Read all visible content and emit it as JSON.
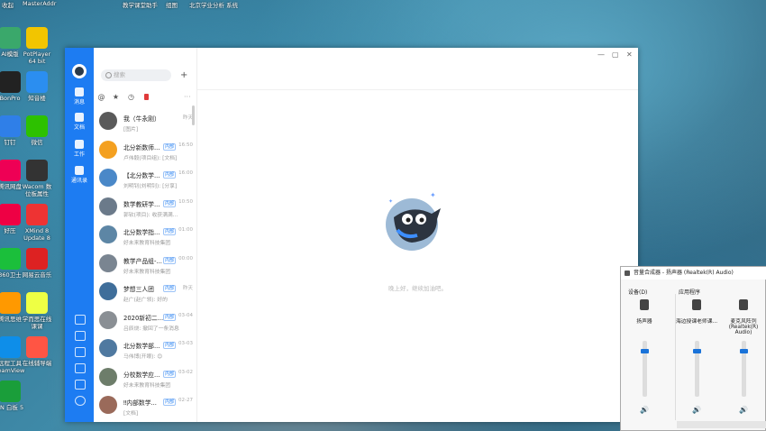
{
  "desktop": {
    "top_labels": [
      "收起",
      "MasterAddr",
      "教学课堂助手",
      "组图",
      "北京学业分析\n系统"
    ],
    "icons": [
      {
        "label": "AI模版",
        "color": "#3aa86b"
      },
      {
        "label": "PotPlayer 64 bit",
        "color": "#f2c500"
      },
      {
        "label": "BonPro",
        "color": "#222"
      },
      {
        "label": "知音楼",
        "color": "#2b8ef0"
      },
      {
        "label": "钉钉",
        "color": "#2f7fe8"
      },
      {
        "label": "微信",
        "color": "#2dc100"
      },
      {
        "label": "腾讯网盘",
        "color": "#e05"
      },
      {
        "label": "Wacom 数位板属性",
        "color": "#333"
      },
      {
        "label": "好压",
        "color": "#e04"
      },
      {
        "label": "XMind 8 Update 8",
        "color": "#e33"
      },
      {
        "label": "360卫士",
        "color": "#1bbf3b"
      },
      {
        "label": "网易云音乐",
        "color": "#d22"
      },
      {
        "label": "腾讯思维",
        "color": "#ff9900"
      },
      {
        "label": "学而思在线课课",
        "color": "#ef4"
      },
      {
        "label": "远程工具 TeamView",
        "color": "#0e8ee9"
      },
      {
        "label": "在线辅导端",
        "color": "#f54"
      },
      {
        "label": "EN 白板 5",
        "color": "#1a9e3a"
      }
    ]
  },
  "main_window": {
    "search": {
      "placeholder": "搜索"
    },
    "add_label": "+",
    "rail": [
      {
        "label": "消息"
      },
      {
        "label": "文档"
      },
      {
        "label": "工作"
      },
      {
        "label": "通讯录"
      }
    ],
    "filters": {
      "mention": "@",
      "star": "★",
      "clock": "◷",
      "more": "···"
    },
    "chats": [
      {
        "name": "我（牛永刚）",
        "badge": "",
        "time": "昨天",
        "preview": "[图片]",
        "avatar": "#5a5a5a"
      },
      {
        "name": "北分新数师...",
        "badge": "内部",
        "time": "16:50",
        "preview": "卢伟毅(项目组): [文档]",
        "avatar": "#f4a020"
      },
      {
        "name": "【北分数学...",
        "badge": "内部",
        "time": "16:00",
        "preview": "刘明钊(刘明钊): [分享]",
        "avatar": "#4a88c8"
      },
      {
        "name": "数学教研学...",
        "badge": "内部",
        "time": "10:50",
        "preview": "郭钦(项目): 收获满满...",
        "avatar": "#6b7a8a"
      },
      {
        "name": "北分数学指...",
        "badge": "内部",
        "time": "01:00",
        "preview": "好未来教育科技集团",
        "avatar": "#5d86a5"
      },
      {
        "name": "教学产品组-...",
        "badge": "内部",
        "time": "00:00",
        "preview": "好未来教育科技集团",
        "avatar": "#7a8591"
      },
      {
        "name": "梦想三人团",
        "badge": "内部",
        "time": "昨天",
        "preview": "赵广(赵广领): 好的",
        "avatar": "#3f6e9a"
      },
      {
        "name": "2020新初二...",
        "badge": "内部",
        "time": "03-04",
        "preview": "吕辰烧: 撤回了一条消息",
        "avatar": "#8a8f94"
      },
      {
        "name": "北分数学部...",
        "badge": "内部",
        "time": "03-03",
        "preview": "马伟博(开眼): 😊",
        "avatar": "#4f79a0"
      },
      {
        "name": "分校数学应...",
        "badge": "内部",
        "time": "03-02",
        "preview": "好未来教育科技集团",
        "avatar": "#6d7d6a"
      },
      {
        "name": "‼内部数学...",
        "badge": "内部",
        "time": "02-27",
        "preview": "[文档]",
        "avatar": "#9a6a5a"
      }
    ],
    "window_controls": {
      "minimize": "—",
      "maximize": "▢",
      "close": "✕"
    },
    "empty_text": "晚上好，继续加油吧。"
  },
  "mixer": {
    "title": "音量合成器 - 扬声器 (Realtek(R) Audio)",
    "device_label": "设备(D)",
    "apps_label": "应用程序",
    "columns": [
      {
        "name": "扬声器",
        "level": 0.8
      },
      {
        "name": "海边授课老师课...",
        "level": 0.8
      },
      {
        "name": "麦克风阵列 (Realtek(R) Audio)",
        "level": 0.8
      }
    ],
    "speaker_glyph": "🔊"
  },
  "colors": {
    "rail_blue": "#1d7cf2",
    "badge_blue": "#1d7cf2",
    "slider_blue": "#1a73d9"
  }
}
